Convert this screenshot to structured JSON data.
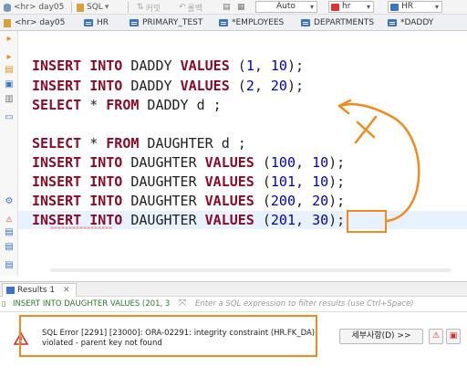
{
  "toolbar": {
    "connection": "<hr> day05",
    "sql_label": "SQL",
    "commit_label": "커밋",
    "rollback_label": "롤백",
    "auto_label": "Auto",
    "schema1": "hr",
    "schema2": "HR"
  },
  "tabs": [
    {
      "label": "HR",
      "active": false
    },
    {
      "label": "PRIMARY_TEST",
      "active": false
    },
    {
      "label": "*EMPLOYEES",
      "active": false
    },
    {
      "label": "DEPARTMENTS",
      "active": false
    },
    {
      "label": "*DADDY",
      "active": false
    }
  ],
  "editor": {
    "lines": [
      {
        "kw1": "INSERT INTO",
        "name": " DADDY ",
        "kw2": "VALUES",
        "args": " (",
        "n1": "1",
        "sep": ", ",
        "n2": "10",
        "tail": ");"
      },
      {
        "kw1": "INSERT INTO",
        "name": " DADDY ",
        "kw2": "VALUES",
        "args": " (",
        "n1": "2",
        "sep": ", ",
        "n2": "20",
        "tail": ");"
      },
      {
        "kw1": "SELECT",
        "mid": " * ",
        "kw2": "FROM",
        "rest": " DADDY d ;"
      },
      {
        "kw1": "SELECT",
        "mid": " * ",
        "kw2": "FROM",
        "rest": " DAUGHTER d ;"
      },
      {
        "kw1": "INSERT INTO",
        "name": " DAUGHTER ",
        "kw2": "VALUES",
        "args": " (",
        "n1": "100",
        "sep": ", ",
        "n2": "10",
        "tail": ");"
      },
      {
        "kw1": "INSERT INTO",
        "name": " DAUGHTER ",
        "kw2": "VALUES",
        "args": " (",
        "n1": "101",
        "sep": ", ",
        "n2": "10",
        "tail": ");"
      },
      {
        "kw1": "INSERT INTO",
        "name": " DAUGHTER ",
        "kw2": "VALUES",
        "args": " (",
        "n1": "200",
        "sep": ", ",
        "n2": "20",
        "tail": ");"
      },
      {
        "kw1": "INSERT INTO",
        "name": " DAUGHTER ",
        "kw2": "VALUES",
        "args": " (",
        "n1": "201",
        "sep": ", ",
        "n2": "30",
        "tail": ");"
      }
    ]
  },
  "results": {
    "tab_label": "Results 1",
    "close": "✕",
    "query_preview": "INSERT INTO DAUGHTER VALUES (201, 3",
    "filter_placeholder": "Enter a SQL expression to filter results (use Ctrl+Space)",
    "error_text": "SQL Error [2291] [23000]: ORA-02291: integrity constraint (HR.FK_DA) violated - parent key not found",
    "details_button": "세부사항(D) >>"
  },
  "colors": {
    "keyword": "#8b0a26",
    "number": "#0000c0",
    "annotation": "#f08a1c",
    "error": "#e03030"
  }
}
